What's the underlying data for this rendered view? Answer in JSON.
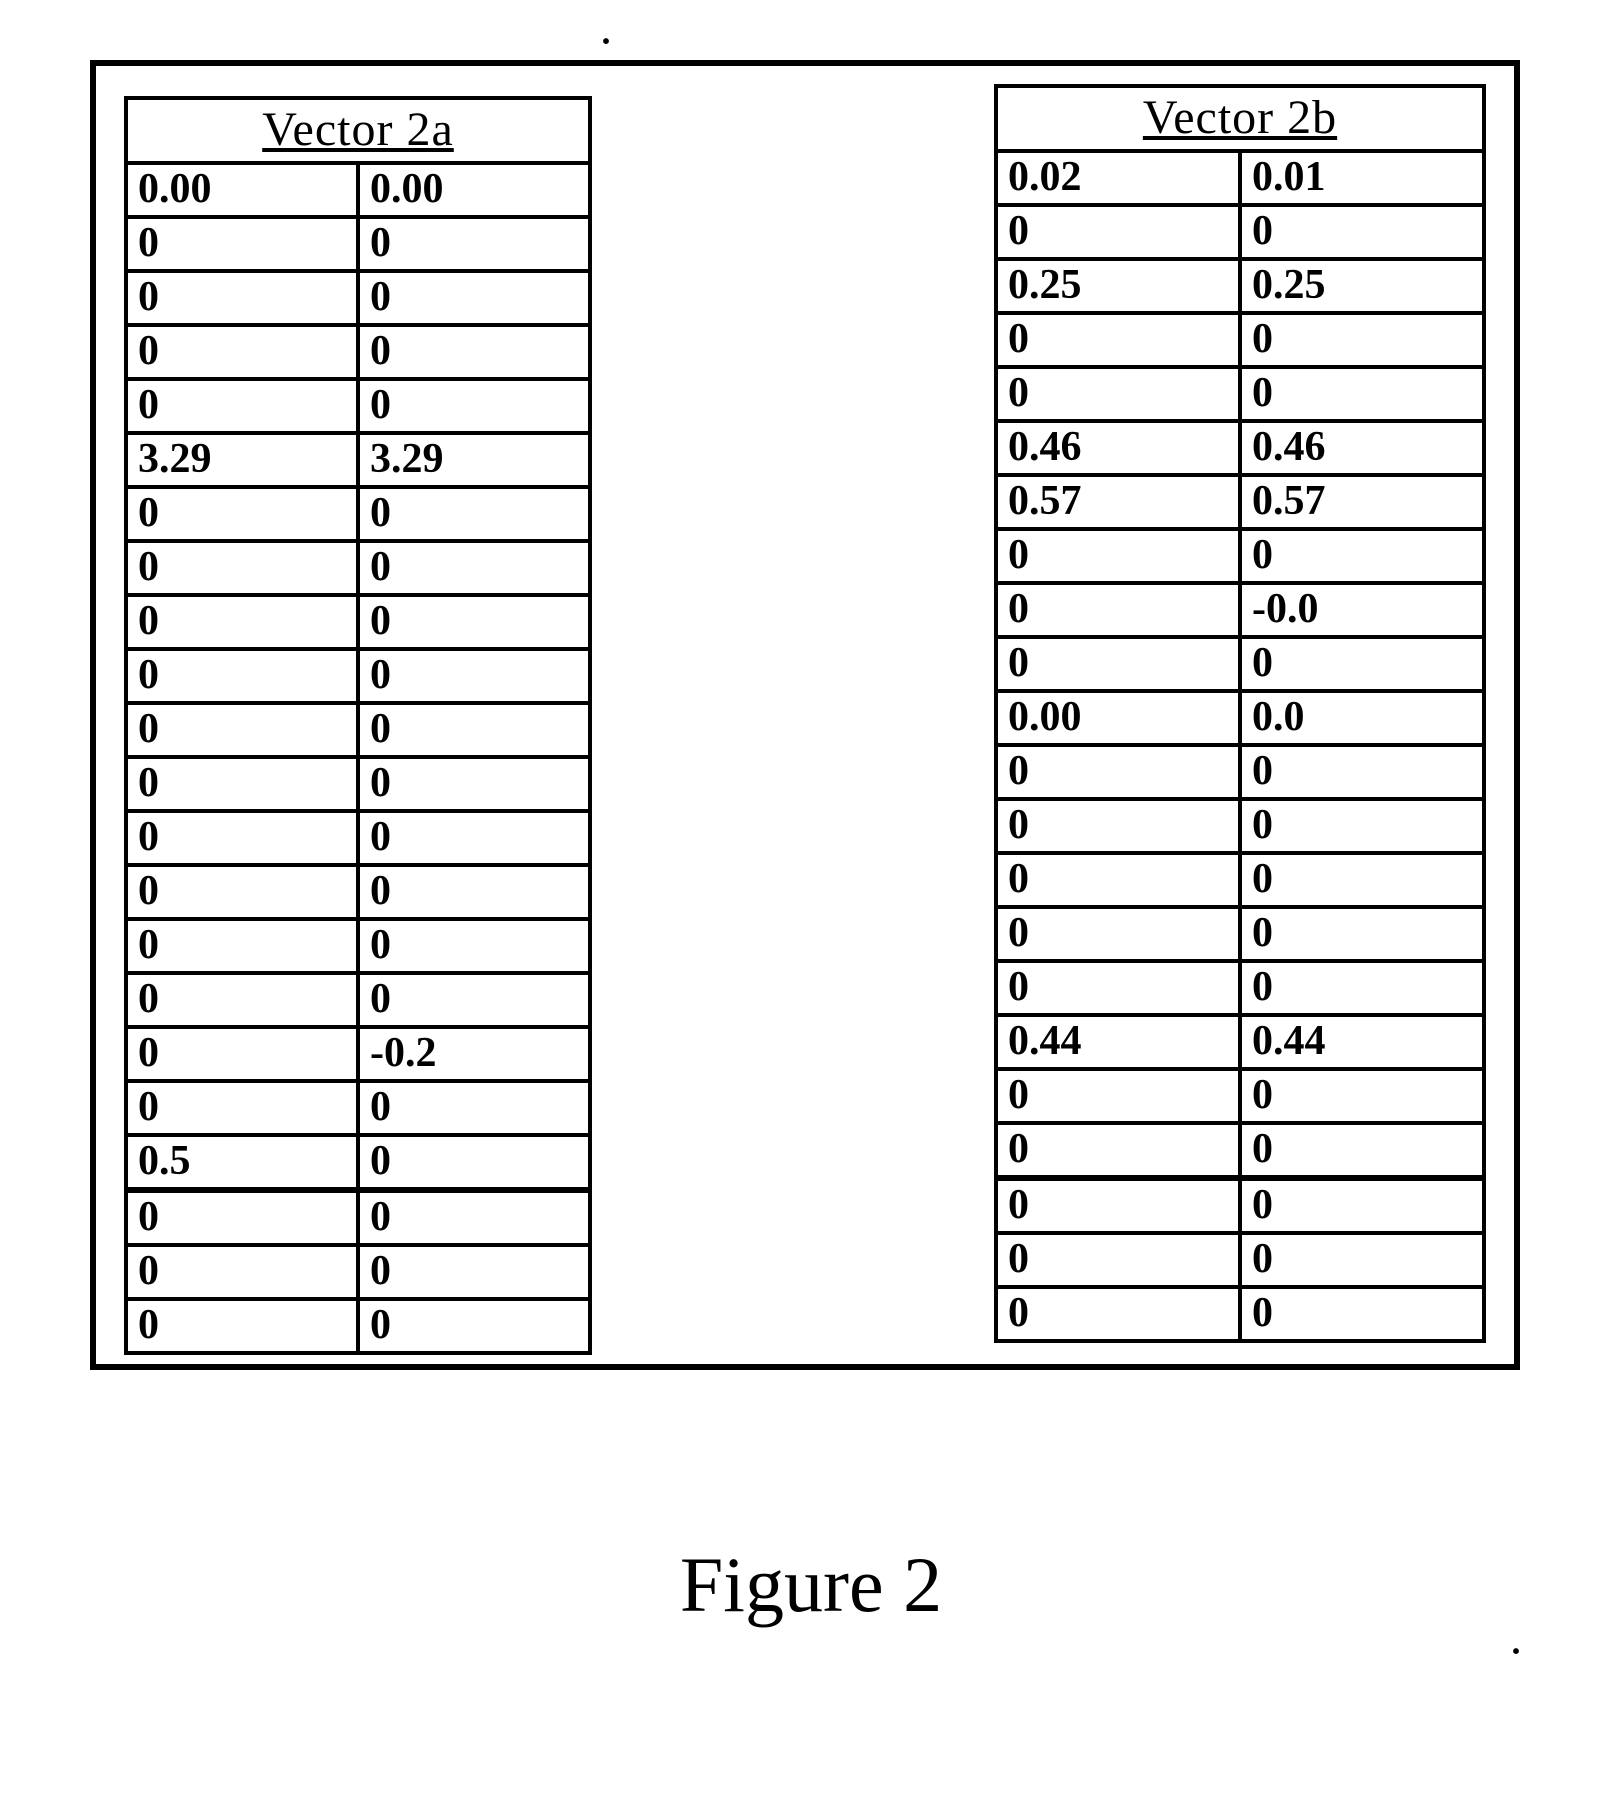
{
  "caption": "Figure 2",
  "tableA": {
    "title": "Vector 2a",
    "rows": [
      [
        "0.00",
        "0.00"
      ],
      [
        "0",
        "0"
      ],
      [
        "0",
        "0"
      ],
      [
        "0",
        "0"
      ],
      [
        "0",
        "0"
      ],
      [
        "3.29",
        "3.29"
      ],
      [
        "0",
        "0"
      ],
      [
        "0",
        "0"
      ],
      [
        "0",
        "0"
      ],
      [
        "0",
        "0"
      ],
      [
        "0",
        "0"
      ],
      [
        "0",
        "0"
      ],
      [
        "0",
        "0"
      ],
      [
        "0",
        "0"
      ],
      [
        "0",
        "0"
      ],
      [
        "0",
        "0"
      ],
      [
        "0",
        "-0.2"
      ],
      [
        "0",
        "0"
      ],
      [
        "0.5",
        "0"
      ],
      [
        "0",
        "0"
      ],
      [
        "0",
        "0"
      ],
      [
        "0",
        "0"
      ]
    ]
  },
  "tableB": {
    "title": "Vector 2b",
    "rows": [
      [
        "0.02",
        "0.01"
      ],
      [
        "0",
        "0"
      ],
      [
        "0.25",
        "0.25"
      ],
      [
        "0",
        "0"
      ],
      [
        "0",
        "0"
      ],
      [
        "0.46",
        "0.46"
      ],
      [
        "0.57",
        "0.57"
      ],
      [
        "0",
        "0"
      ],
      [
        "0",
        "-0.0"
      ],
      [
        "0",
        "0"
      ],
      [
        "0.00",
        "0.0"
      ],
      [
        "0",
        "0"
      ],
      [
        "0",
        "0"
      ],
      [
        "0",
        "0"
      ],
      [
        "0",
        "0"
      ],
      [
        "0",
        "0"
      ],
      [
        "0.44",
        "0.44"
      ],
      [
        "0",
        "0"
      ],
      [
        "0",
        "0"
      ],
      [
        "0",
        "0"
      ],
      [
        "0",
        "0"
      ],
      [
        "0",
        "0"
      ]
    ]
  }
}
